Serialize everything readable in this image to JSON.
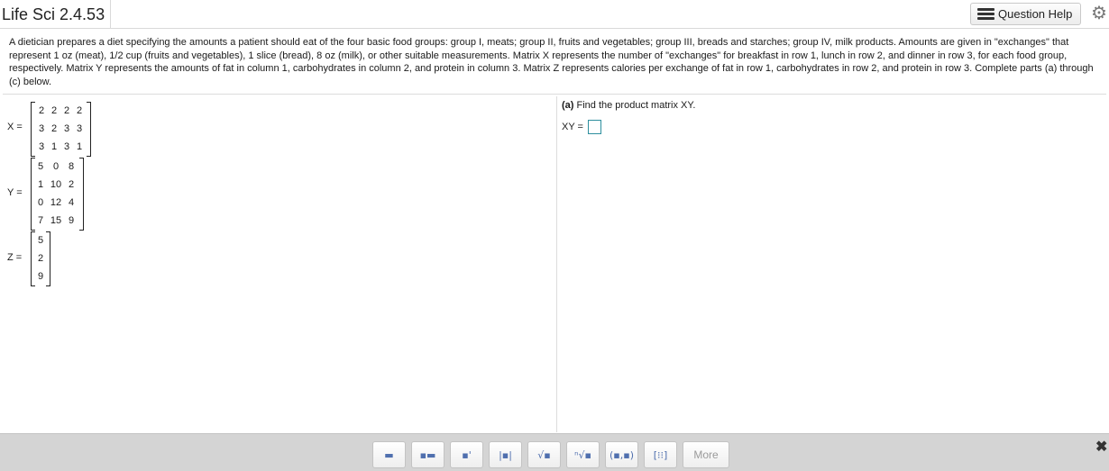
{
  "header": {
    "title": "Life Sci 2.4.53",
    "help_label": "Question Help",
    "help_icon": "list-icon",
    "settings_icon": "gear-icon"
  },
  "problem_text": "A dietician prepares a diet specifying the amounts a patient should eat of the four basic food groups: group I, meats; group II, fruits and vegetables; group III, breads and starches; group IV, milk products. Amounts are given in \"exchanges\" that represent 1 oz (meat), 1/2 cup (fruits and vegetables), 1 slice (bread), 8 oz (milk), or other suitable measurements. Matrix X represents the number of \"exchanges\" for breakfast in row 1, lunch in row 2, and dinner in row 3, for each food group, respectively. Matrix Y represents the amounts of fat in column 1, carbohydrates in column 2, and protein in column 3. Matrix Z represents calories per exchange of fat in row 1, carbohydrates in row 2, and protein in row 3. Complete parts (a) through (c) below.",
  "matrices": {
    "X": {
      "label": "X =",
      "rows": [
        [
          "2",
          "2",
          "2",
          "2"
        ],
        [
          "3",
          "2",
          "3",
          "3"
        ],
        [
          "3",
          "1",
          "3",
          "1"
        ]
      ]
    },
    "Y": {
      "label": "Y =",
      "rows": [
        [
          "5",
          "0",
          "8"
        ],
        [
          "1",
          "10",
          "2"
        ],
        [
          "0",
          "12",
          "4"
        ],
        [
          "7",
          "15",
          "9"
        ]
      ]
    },
    "Z": {
      "label": "Z =",
      "rows": [
        [
          "5"
        ],
        [
          "2"
        ],
        [
          "9"
        ]
      ]
    }
  },
  "part_a": {
    "prefix": "(a)",
    "text": " Find the product matrix XY.",
    "answer_label": "XY =",
    "answer_value": ""
  },
  "toolbar": {
    "tools": [
      {
        "name": "fraction-tool",
        "glyph": "▬"
      },
      {
        "name": "mixed-number-tool",
        "glyph": "▪▬"
      },
      {
        "name": "exponent-tool",
        "glyph": "▪'"
      },
      {
        "name": "absolute-value-tool",
        "glyph": "|▪|"
      },
      {
        "name": "square-root-tool",
        "glyph": "√▪"
      },
      {
        "name": "nth-root-tool",
        "glyph": "ⁿ√▪"
      },
      {
        "name": "ordered-pair-tool",
        "glyph": "(▪,▪)"
      },
      {
        "name": "matrix-tool",
        "glyph": "[⁝⁝]"
      }
    ],
    "more_label": "More",
    "close_icon": "close-icon",
    "close_glyph": "✖"
  },
  "colors": {
    "answer_box_border": "#2e8f9e",
    "toolbar_icon": "#4f6fae",
    "footer_bg": "#d4d4d4"
  }
}
